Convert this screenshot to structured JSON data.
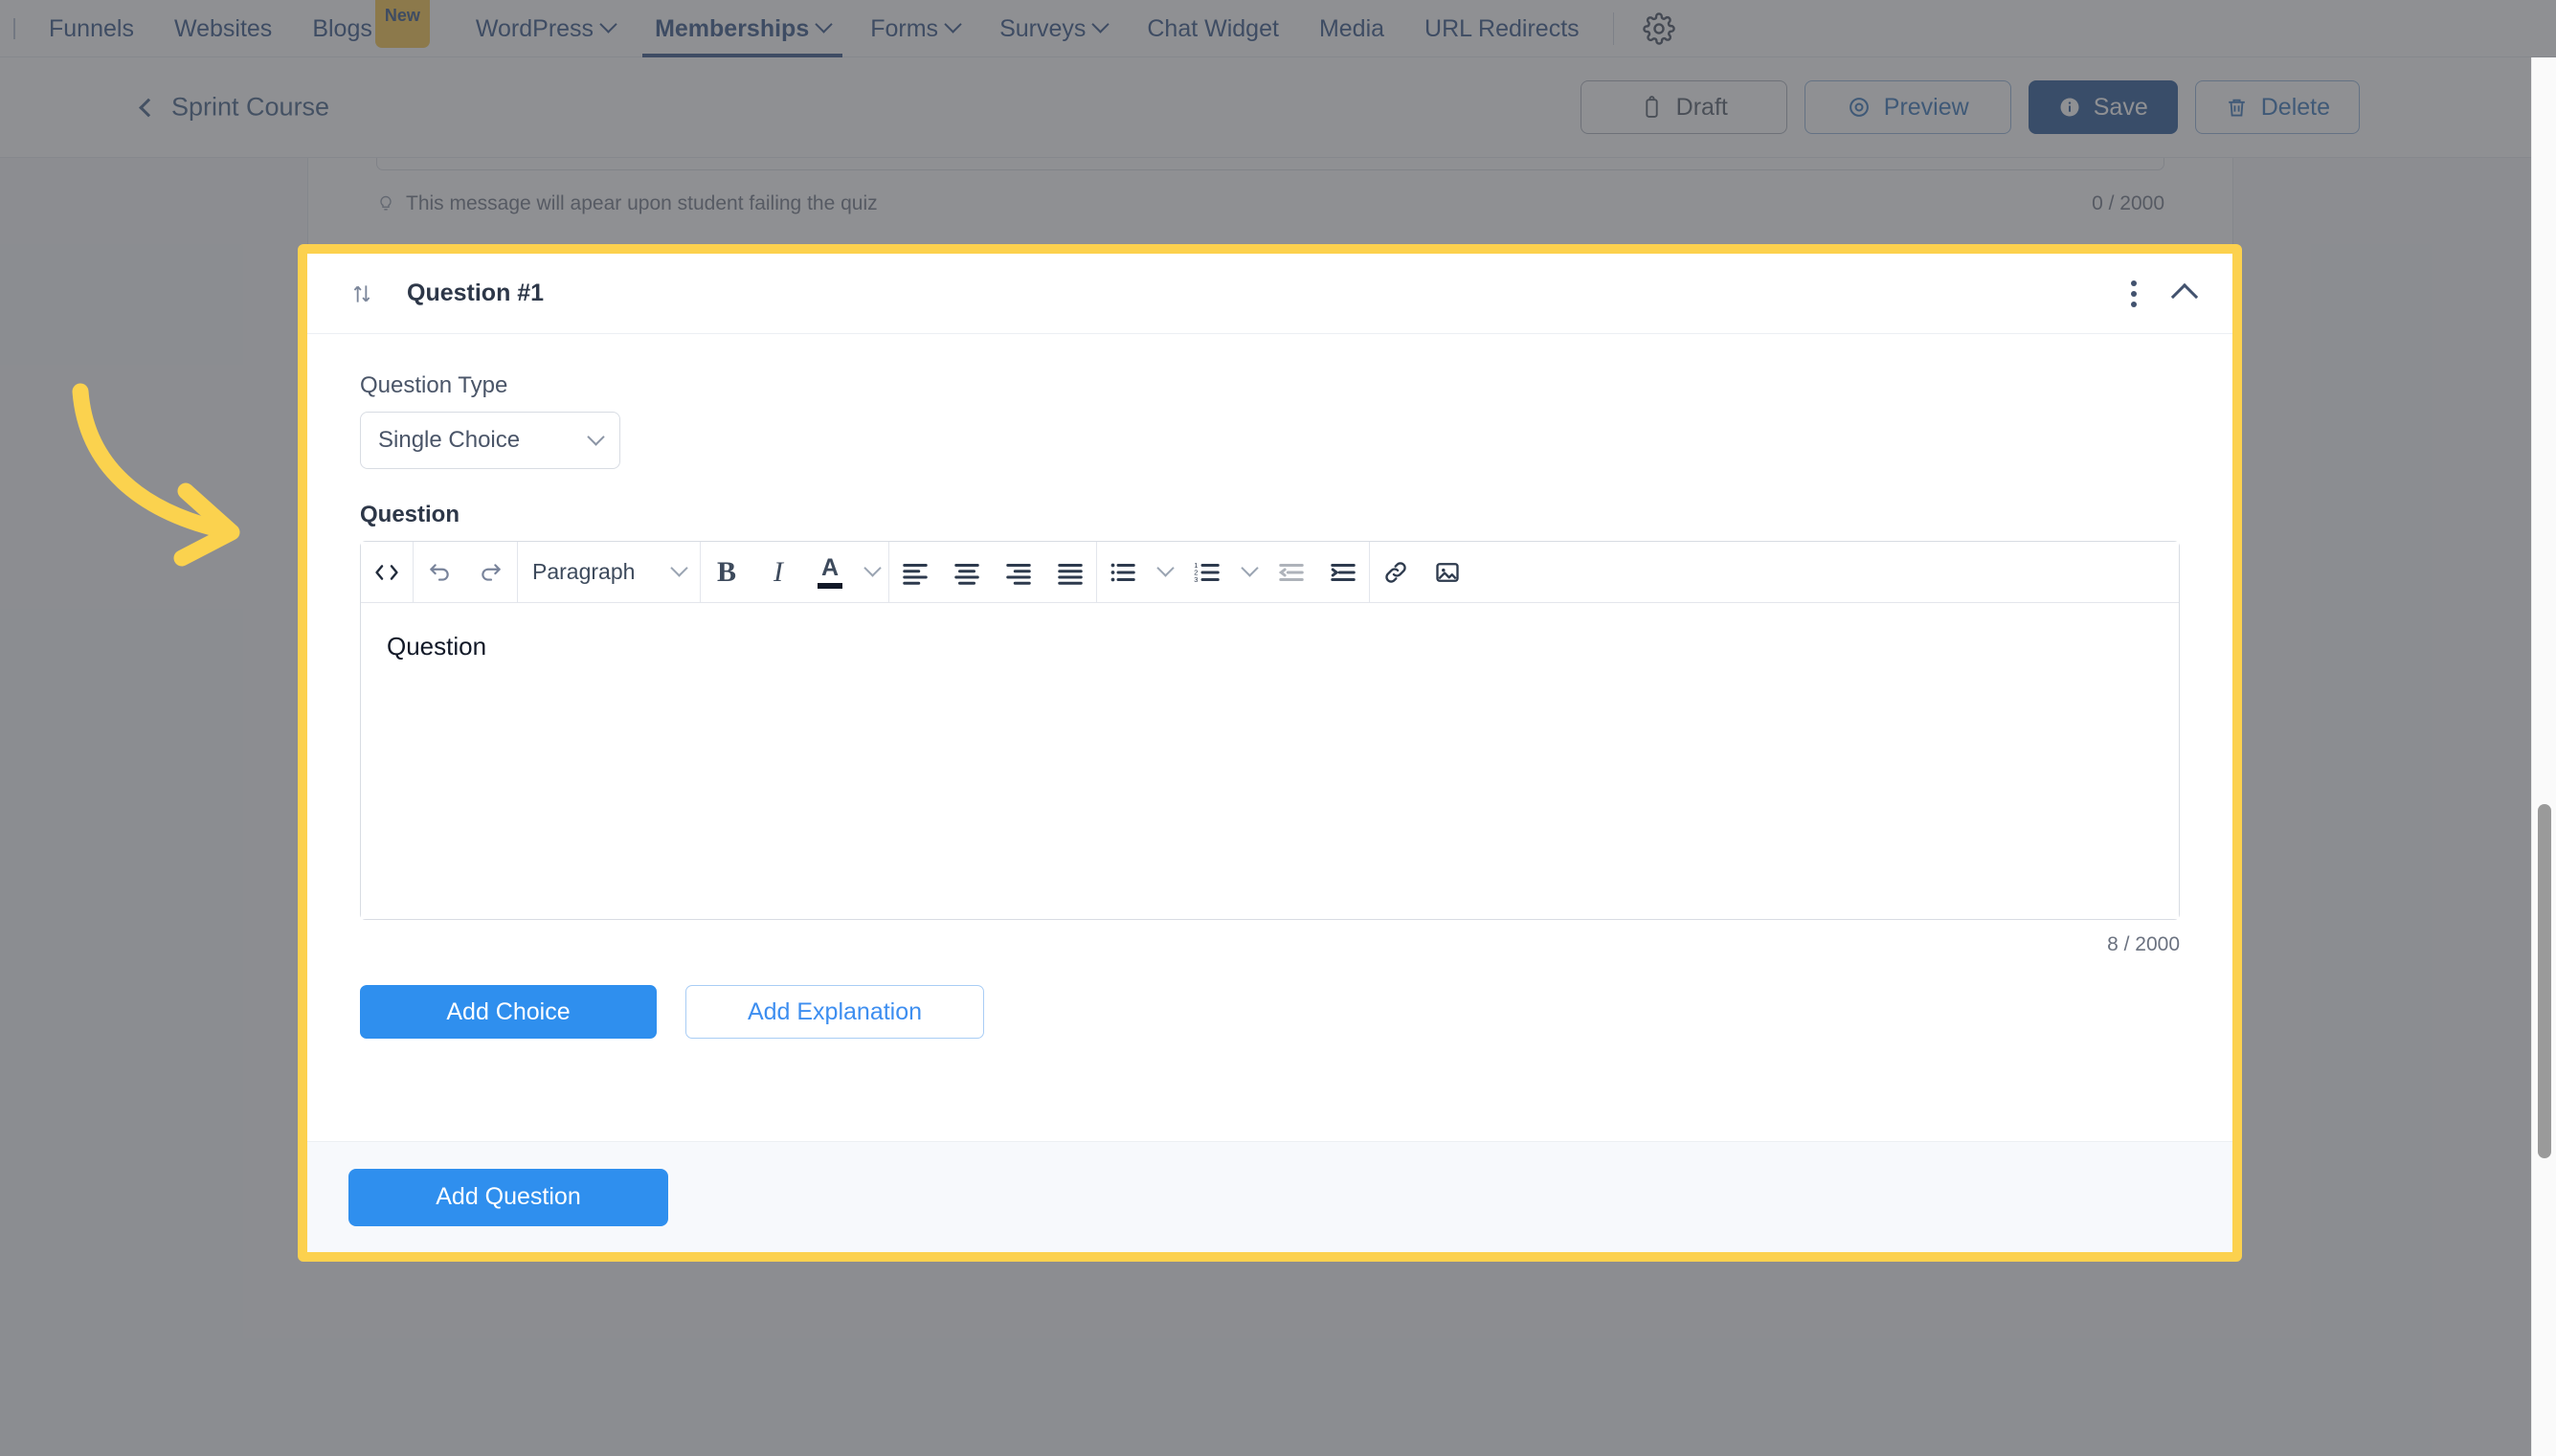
{
  "topnav": {
    "items": [
      {
        "label": "Funnels",
        "caret": false,
        "badge": null,
        "active": false
      },
      {
        "label": "Websites",
        "caret": false,
        "badge": null,
        "active": false
      },
      {
        "label": "Blogs",
        "caret": false,
        "badge": "New",
        "active": false
      },
      {
        "label": "WordPress",
        "caret": true,
        "badge": null,
        "active": false
      },
      {
        "label": "Memberships",
        "caret": true,
        "badge": null,
        "active": true
      },
      {
        "label": "Forms",
        "caret": true,
        "badge": null,
        "active": false
      },
      {
        "label": "Surveys",
        "caret": true,
        "badge": null,
        "active": false
      },
      {
        "label": "Chat Widget",
        "caret": false,
        "badge": null,
        "active": false
      },
      {
        "label": "Media",
        "caret": false,
        "badge": null,
        "active": false
      },
      {
        "label": "URL Redirects",
        "caret": false,
        "badge": null,
        "active": false
      }
    ],
    "settings_icon": "gear-icon",
    "accent_color": "#2c4d82",
    "badge_color": "#f6c343"
  },
  "header": {
    "breadcrumb_label": "Sprint Course",
    "actions": {
      "draft": "Draft",
      "preview": "Preview",
      "save": "Save",
      "delete": "Delete"
    },
    "save_color": "#1d4f91"
  },
  "top_card": {
    "hint_text": "This message will apear upon student failing the quiz",
    "counter": "0 / 2000"
  },
  "question_card": {
    "title": "Question #1",
    "drag_icon": "sort-arrows-icon",
    "menu_icon": "kebab-menu-icon",
    "collapse_icon": "chevron-up-icon",
    "highlight_color": "#fcd14e",
    "question_type": {
      "label": "Question Type",
      "value": "Single Choice"
    },
    "question_field": {
      "label": "Question",
      "content": "Question",
      "counter": "8 / 2000"
    },
    "editor_toolbar": {
      "code_view": "<>",
      "undo": "undo-icon",
      "redo": "redo-icon",
      "block_format": "Paragraph",
      "bold": "B",
      "italic": "I",
      "text_color": "A",
      "align_left": "align-left-icon",
      "align_center": "align-center-icon",
      "align_right": "align-right-icon",
      "align_justify": "align-justify-icon",
      "bullet_list": "bullet-list-icon",
      "numbered_list": "numbered-list-icon",
      "outdent": "outdent-icon",
      "indent": "indent-icon",
      "link": "link-icon",
      "image": "image-icon"
    },
    "actions": {
      "add_choice": "Add Choice",
      "add_explanation": "Add Explanation"
    },
    "footer": {
      "add_question": "Add Question"
    },
    "primary_color": "#2f8fee"
  },
  "annotation": {
    "arrow_color": "#fbd24e",
    "arrow_name": "curved-arrow-pointer"
  }
}
